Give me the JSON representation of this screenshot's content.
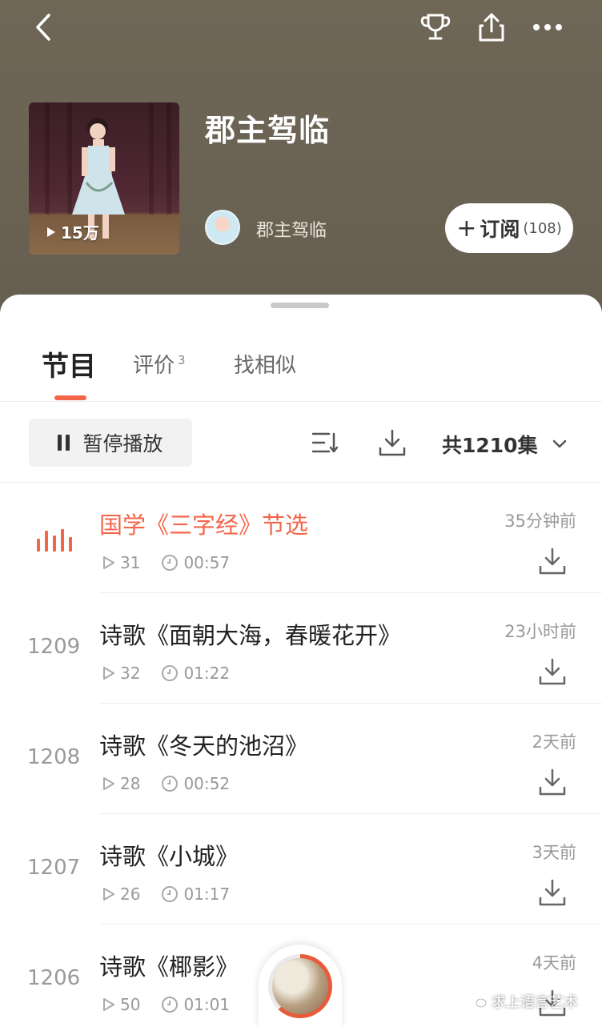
{
  "album": {
    "title": "郡主驾临",
    "play_count": "15万",
    "author": "郡主驾临",
    "subscribe_label": "订阅",
    "subscribe_count": "(108)"
  },
  "tabs": [
    {
      "label": "节目",
      "active": true
    },
    {
      "label": "评价",
      "badge": "3"
    },
    {
      "label": "找相似"
    }
  ],
  "toolbar": {
    "pause_label": "暂停播放",
    "total_label": "共1210集"
  },
  "episodes": [
    {
      "num": "",
      "title": "国学《三字经》节选",
      "plays": "31",
      "duration": "00:57",
      "time": "35分钟前",
      "playing": true
    },
    {
      "num": "1209",
      "title": "诗歌《面朝大海，春暖花开》",
      "plays": "32",
      "duration": "01:22",
      "time": "23小时前"
    },
    {
      "num": "1208",
      "title": "诗歌《冬天的池沼》",
      "plays": "28",
      "duration": "00:52",
      "time": "2天前"
    },
    {
      "num": "1207",
      "title": "诗歌《小城》",
      "plays": "26",
      "duration": "01:17",
      "time": "3天前"
    },
    {
      "num": "1206",
      "title": "诗歌《椰影》",
      "plays": "50",
      "duration": "01:01",
      "time": "4天前"
    }
  ],
  "watermark": "求上语言艺术",
  "colors": {
    "accent": "#f4664a",
    "header_bg": "#6b6354"
  }
}
